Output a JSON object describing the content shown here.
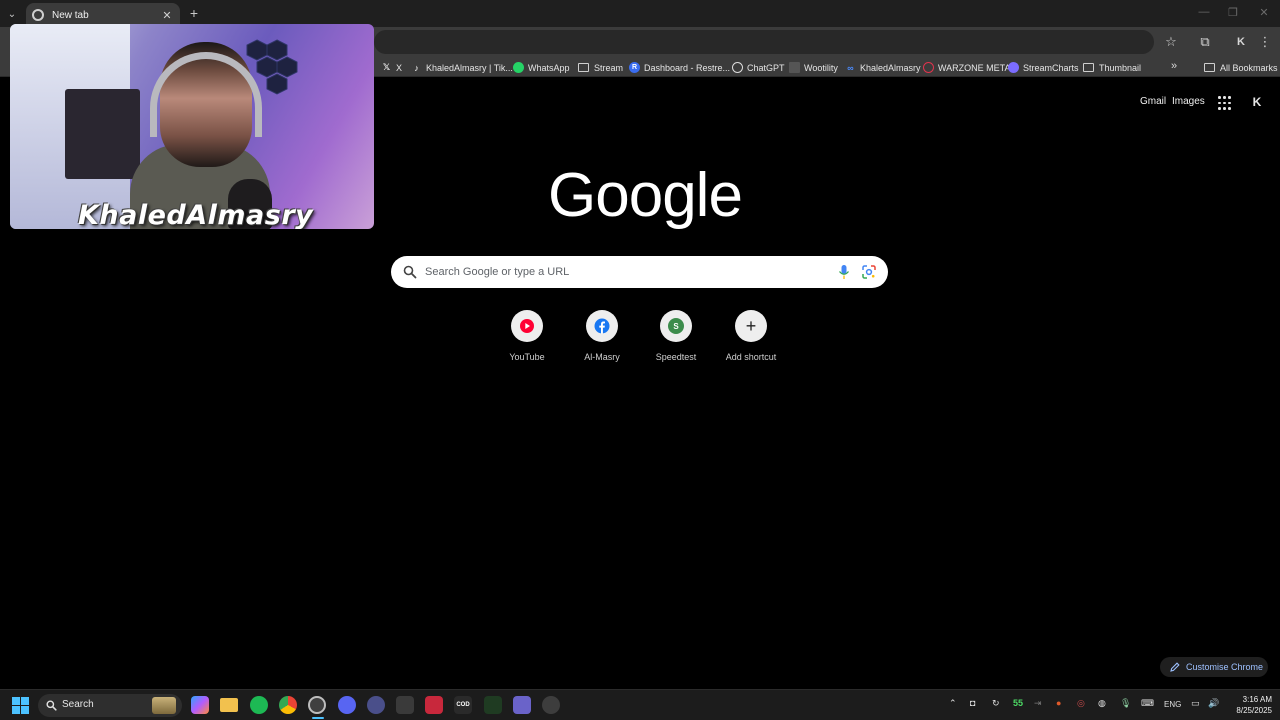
{
  "browser": {
    "tab_title": "New tab",
    "tab_close": "✕",
    "new_tab": "+",
    "tab_menu": "⌄",
    "window_controls": {
      "minimize": "—",
      "restore": "❐",
      "close": "✕"
    },
    "toolbar_icons": {
      "bookmark_star": "☆",
      "extensions": "⧉",
      "profile": "K",
      "menu": "⋮"
    }
  },
  "bookmarks": {
    "items": [
      {
        "label": "X",
        "icon": "x-logo"
      },
      {
        "label": "KhaledAlmasry | Tik...",
        "icon": "tiktok-logo"
      },
      {
        "label": "WhatsApp",
        "icon": "whatsapp-logo",
        "color": "#25d366"
      },
      {
        "label": "Stream",
        "icon": "folder"
      },
      {
        "label": "Dashboard - Restre...",
        "icon": "restream-logo",
        "color": "#3a6df0"
      },
      {
        "label": "ChatGPT",
        "icon": "chatgpt-logo"
      },
      {
        "label": "Wootility",
        "icon": "wooting-logo"
      },
      {
        "label": "KhaledAlmasry",
        "icon": "meta-logo",
        "color": "#4a8cff"
      },
      {
        "label": "WARZONE META",
        "icon": "warzone-logo",
        "color": "#e0334d"
      },
      {
        "label": "StreamCharts",
        "icon": "streamcharts-logo",
        "color": "#7b6cff"
      },
      {
        "label": "Thumbnail",
        "icon": "folder"
      }
    ],
    "more": "»",
    "all_bookmarks": "All Bookmarks"
  },
  "overlay": {
    "streamer_name": "KhaledAlmasry"
  },
  "ntp": {
    "gmail": "Gmail",
    "images": "Images",
    "logo_text": "Google",
    "search_placeholder": "Search Google or type a URL",
    "shortcuts": [
      {
        "label": "YouTube",
        "icon": "youtube-icon",
        "color": "#ff0033"
      },
      {
        "label": "Al-Masry",
        "icon": "facebook-icon",
        "color": "#1877f2"
      },
      {
        "label": "Speedtest",
        "icon": "speedtest-icon",
        "color": "#3c8c4c",
        "letter": "S"
      },
      {
        "label": "Add shortcut",
        "icon": "plus-icon",
        "letter": "+"
      }
    ],
    "customise": "Customise Chrome"
  },
  "taskbar": {
    "search_label": "Search",
    "apps": [
      {
        "name": "copilot",
        "color": "#6a5cff"
      },
      {
        "name": "file-explorer",
        "color": "#f2c14e"
      },
      {
        "name": "spotify",
        "color": "#1db954"
      },
      {
        "name": "chrome",
        "color": "#e8453c"
      },
      {
        "name": "chrome-active",
        "color": "#444444"
      },
      {
        "name": "discord",
        "color": "#5865f2",
        "badge": "9+"
      },
      {
        "name": "app-1",
        "color": "#4a4f8a"
      },
      {
        "name": "app-2",
        "color": "#3a3a3a"
      },
      {
        "name": "valorant",
        "color": "#c8283c"
      },
      {
        "name": "call-of-duty",
        "color": "#2a2a2a",
        "letter": "COD"
      },
      {
        "name": "razer",
        "color": "#1f3b22"
      },
      {
        "name": "game-controller",
        "color": "#6a63c9"
      },
      {
        "name": "settings",
        "color": "#3d3d3d"
      }
    ],
    "tray": {
      "fps_value": "55",
      "language": "ENG"
    },
    "time": "3:16 AM",
    "date": "8/25/2025"
  }
}
